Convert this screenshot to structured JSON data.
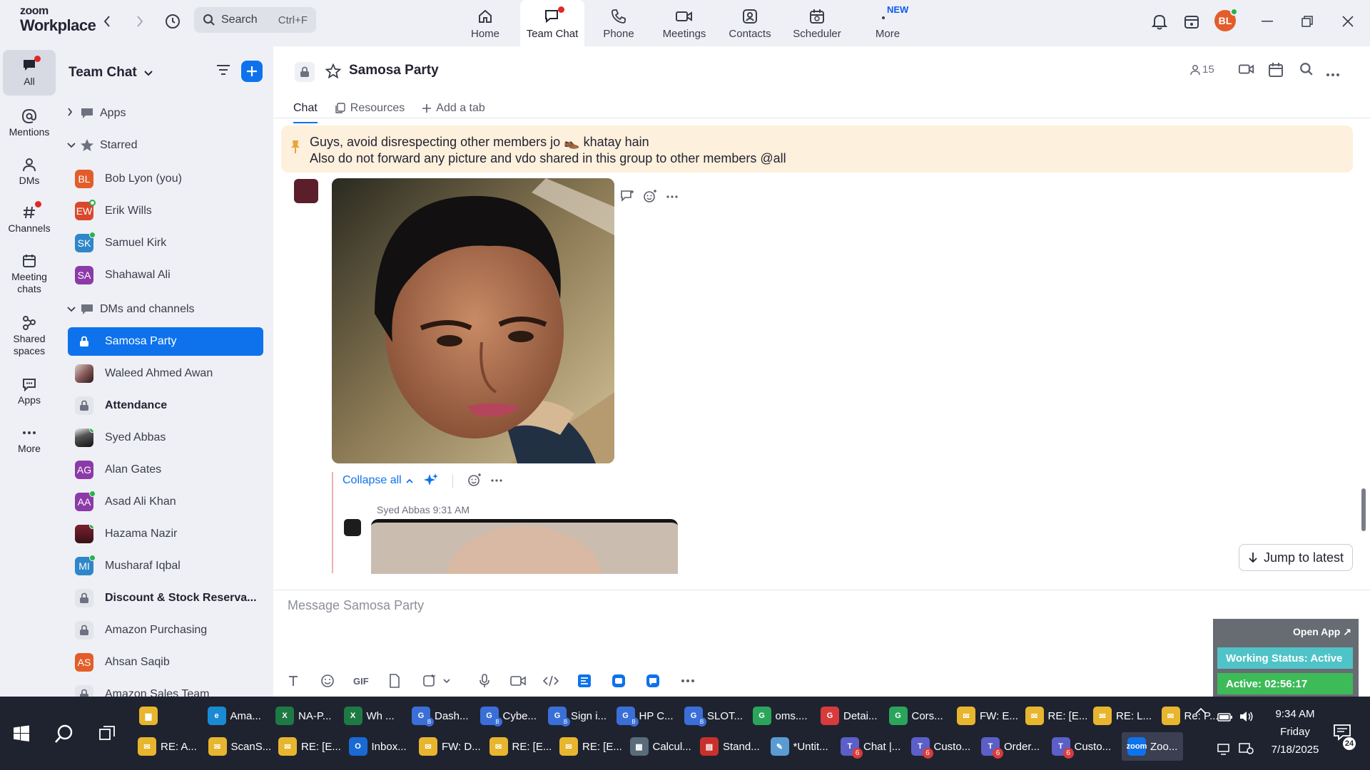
{
  "app": {
    "logo_line1": "zoom",
    "logo_line2": "Workplace"
  },
  "search": {
    "placeholder": "Search",
    "shortcut": "Ctrl+F"
  },
  "nav": [
    {
      "label": "Home",
      "icon": "home-icon"
    },
    {
      "label": "Team Chat",
      "icon": "chat-icon",
      "active": true
    },
    {
      "label": "Phone",
      "icon": "phone-icon"
    },
    {
      "label": "Meetings",
      "icon": "video-icon"
    },
    {
      "label": "Contacts",
      "icon": "contacts-icon"
    },
    {
      "label": "Scheduler",
      "icon": "calendar-icon"
    },
    {
      "label": "More",
      "icon": "more-icon",
      "badge": "NEW"
    }
  ],
  "profile": {
    "initials": "BL"
  },
  "rail": [
    {
      "label": "All",
      "icon": "chat-bubble-icon"
    },
    {
      "label": "Mentions",
      "icon": "at-icon"
    },
    {
      "label": "DMs",
      "icon": "people-icon"
    },
    {
      "label": "Channels",
      "icon": "hash-icon"
    },
    {
      "label": "Meeting chats",
      "icon": "calendar-icon"
    },
    {
      "label": "Shared spaces",
      "icon": "shared-icon"
    },
    {
      "label": "Apps",
      "icon": "apps-icon"
    },
    {
      "label": "More",
      "icon": "more-icon"
    }
  ],
  "sidebar": {
    "title": "Team Chat",
    "sections": {
      "apps": "Apps",
      "starred": "Starred",
      "dms": "DMs and channels"
    },
    "starred": [
      {
        "name": "Bob Lyon (you)",
        "initials": "BL",
        "color": "#e35d2a"
      },
      {
        "name": "Erik Wills",
        "initials": "EW",
        "color": "#d9482b"
      },
      {
        "name": "Samuel Kirk",
        "initials": "SK",
        "color": "#2f86c9"
      },
      {
        "name": "Shahawal Ali",
        "initials": "SA",
        "color": "#8c3aa8"
      }
    ],
    "channels": [
      {
        "name": "Samosa Party",
        "kind": "lock"
      },
      {
        "name": "Waleed Ahmed Awan",
        "kind": "photo"
      },
      {
        "name": "Attendance",
        "kind": "lock"
      },
      {
        "name": "Syed Abbas",
        "kind": "photo"
      },
      {
        "name": "Alan Gates",
        "initials": "AG",
        "color": "#8c3aa8"
      },
      {
        "name": "Asad Ali Khan",
        "initials": "AA",
        "color": "#8c3aa8"
      },
      {
        "name": "Hazama Nazir",
        "kind": "photo"
      },
      {
        "name": "Musharaf Iqbal",
        "initials": "MI",
        "color": "#2f86c9"
      },
      {
        "name": "Discount & Stock Reserva...",
        "kind": "lock"
      },
      {
        "name": "Amazon Purchasing",
        "kind": "lock"
      },
      {
        "name": "Ahsan Saqib",
        "initials": "AS",
        "color": "#e35d2a"
      },
      {
        "name": "Amazon Sales Team",
        "kind": "lock"
      }
    ]
  },
  "channel": {
    "title": "Samosa Party",
    "members": "15",
    "tabs": [
      "Chat",
      "Resources",
      "Add a tab"
    ]
  },
  "pinned": {
    "line1": "Guys, avoid disrespecting other members jo 👞 khatay hain",
    "line2": "Also do not forward any picture and vdo shared in this group to other members @all"
  },
  "thread": {
    "collapse": "Collapse all"
  },
  "reply": {
    "sender": "Syed Abbas",
    "time": "9:31 AM"
  },
  "jump_label": "Jump to latest",
  "composer": {
    "placeholder": "Message Samosa Party",
    "gif": "GIF"
  },
  "widget": {
    "open": "Open App",
    "status": "Working Status: Active",
    "active": "Active: 02:56:17"
  },
  "taskbar": {
    "row1": [
      {
        "label": "",
        "color": "#e8b52e",
        "glyph": "▆"
      },
      {
        "label": "Ama...",
        "color": "#1a8ad4",
        "glyph": "e"
      },
      {
        "label": "NA-P...",
        "color": "#1d7a43",
        "glyph": "X"
      },
      {
        "label": "Wh ...",
        "color": "#1d7a43",
        "glyph": "X"
      },
      {
        "label": "Dash...",
        "color": "#3b6fd8",
        "glyph": "G",
        "sub": "B"
      },
      {
        "label": "Cybe...",
        "color": "#3b6fd8",
        "glyph": "G",
        "sub": "B"
      },
      {
        "label": "Sign i...",
        "color": "#3b6fd8",
        "glyph": "G",
        "sub": "B"
      },
      {
        "label": "HP C...",
        "color": "#3b6fd8",
        "glyph": "G",
        "sub": "B"
      },
      {
        "label": "SLOT...",
        "color": "#3b6fd8",
        "glyph": "G",
        "sub": "B"
      },
      {
        "label": "oms....",
        "color": "#2aa55a",
        "glyph": "G"
      },
      {
        "label": "Detai...",
        "color": "#d83b3b",
        "glyph": "G"
      },
      {
        "label": "Cors...",
        "color": "#2aa55a",
        "glyph": "G"
      },
      {
        "label": "FW: E...",
        "color": "#e8b52e",
        "glyph": "✉"
      },
      {
        "label": "RE: [E...",
        "color": "#e8b52e",
        "glyph": "✉"
      },
      {
        "label": "RE: L...",
        "color": "#e8b52e",
        "glyph": "✉"
      },
      {
        "label": "Re: P...",
        "color": "#e8b52e",
        "glyph": "✉"
      }
    ],
    "row2": [
      {
        "label": "RE: A...",
        "color": "#e8b52e",
        "glyph": "✉"
      },
      {
        "label": "ScanS...",
        "color": "#e8b52e",
        "glyph": "✉"
      },
      {
        "label": "RE: [E...",
        "color": "#e8b52e",
        "glyph": "✉"
      },
      {
        "label": "Inbox...",
        "color": "#1a6ad4",
        "glyph": "O"
      },
      {
        "label": "FW: D...",
        "color": "#e8b52e",
        "glyph": "✉"
      },
      {
        "label": "RE: [E...",
        "color": "#e8b52e",
        "glyph": "✉"
      },
      {
        "label": "RE: [E...",
        "color": "#e8b52e",
        "glyph": "✉"
      },
      {
        "label": "Calcul...",
        "color": "#5a6b7a",
        "glyph": "▦"
      },
      {
        "label": "Stand...",
        "color": "#c8312b",
        "glyph": "▤"
      },
      {
        "label": "*Untit...",
        "color": "#5a9bd4",
        "glyph": "✎"
      },
      {
        "label": "Chat |...",
        "color": "#5b5fc7",
        "glyph": "T",
        "badge": "6"
      },
      {
        "label": "Custo...",
        "color": "#5b5fc7",
        "glyph": "T",
        "badge": "6"
      },
      {
        "label": "Order...",
        "color": "#5b5fc7",
        "glyph": "T",
        "badge": "6"
      },
      {
        "label": "Custo...",
        "color": "#5b5fc7",
        "glyph": "T",
        "badge": "6"
      },
      {
        "label": "Zoo...",
        "color": "#0e72ed",
        "glyph": "zoom",
        "active": true
      }
    ],
    "clock": {
      "time": "9:34 AM",
      "day": "Friday",
      "date": "7/18/2025"
    },
    "notifications": "24"
  }
}
